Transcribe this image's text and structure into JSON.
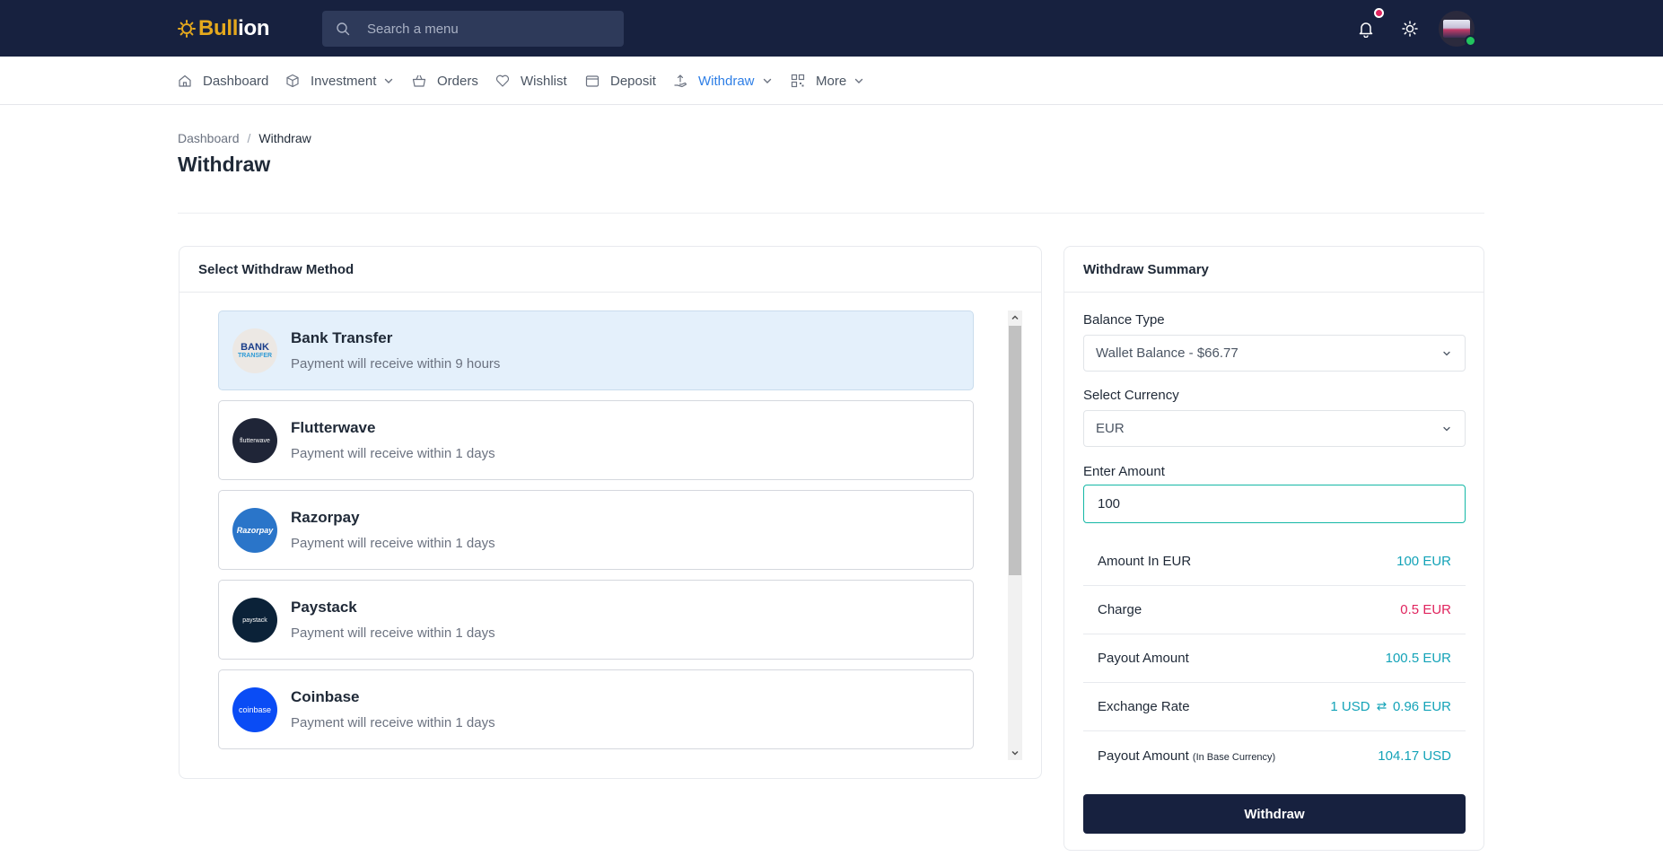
{
  "brand": {
    "name_part1": "Bull",
    "name_part2": "ion"
  },
  "search": {
    "placeholder": "Search a menu"
  },
  "nav": {
    "dashboard": "Dashboard",
    "investment": "Investment",
    "orders": "Orders",
    "wishlist": "Wishlist",
    "deposit": "Deposit",
    "withdraw": "Withdraw",
    "more": "More"
  },
  "breadcrumb": {
    "parent": "Dashboard",
    "separator": "/",
    "current": "Withdraw"
  },
  "page": {
    "title": "Withdraw"
  },
  "methods_card": {
    "title": "Select Withdraw Method",
    "methods": [
      {
        "name": "Bank Transfer",
        "desc": "Payment will receive within 9 hours",
        "logo_text": "BANK",
        "logo_sub": "TRANSFER",
        "selected": true
      },
      {
        "name": "Flutterwave",
        "desc": "Payment will receive within 1 days",
        "logo_text": "flutterwave"
      },
      {
        "name": "Razorpay",
        "desc": "Payment will receive within 1 days",
        "logo_text": "Razorpay"
      },
      {
        "name": "Paystack",
        "desc": "Payment will receive within 1 days",
        "logo_text": "paystack"
      },
      {
        "name": "Coinbase",
        "desc": "Payment will receive within 1 days",
        "logo_text": "coinbase"
      }
    ]
  },
  "summary": {
    "title": "Withdraw Summary",
    "balance_type_label": "Balance Type",
    "balance_type_value": "Wallet Balance - $66.77",
    "currency_label": "Select Currency",
    "currency_value": "EUR",
    "amount_label": "Enter Amount",
    "amount_value": "100",
    "rows": {
      "amount_in": {
        "label": "Amount In EUR",
        "value": "100 EUR"
      },
      "charge": {
        "label": "Charge",
        "value": "0.5 EUR"
      },
      "payout": {
        "label": "Payout Amount",
        "value": "100.5 EUR"
      },
      "exchange": {
        "label": "Exchange Rate",
        "value_from": "1 USD",
        "value_to": "0.96 EUR"
      },
      "payout_base": {
        "label": "Payout Amount",
        "label_small": "(In Base Currency)",
        "value": "104.17 USD"
      }
    },
    "button": "Withdraw"
  },
  "colors": {
    "navy": "#17213f",
    "accent_blue": "#2f7fe6",
    "teal": "#14a3b8",
    "red": "#e0245e",
    "gold": "#e5a91d"
  },
  "icons": [
    "sun-logo-icon",
    "search-icon",
    "bell-icon",
    "theme-sun-icon",
    "home-icon",
    "cube-icon",
    "basket-icon",
    "heart-icon",
    "wallet-icon",
    "withdraw-hand-icon",
    "qr-icon",
    "chevron-down-icon",
    "exchange-icon"
  ]
}
